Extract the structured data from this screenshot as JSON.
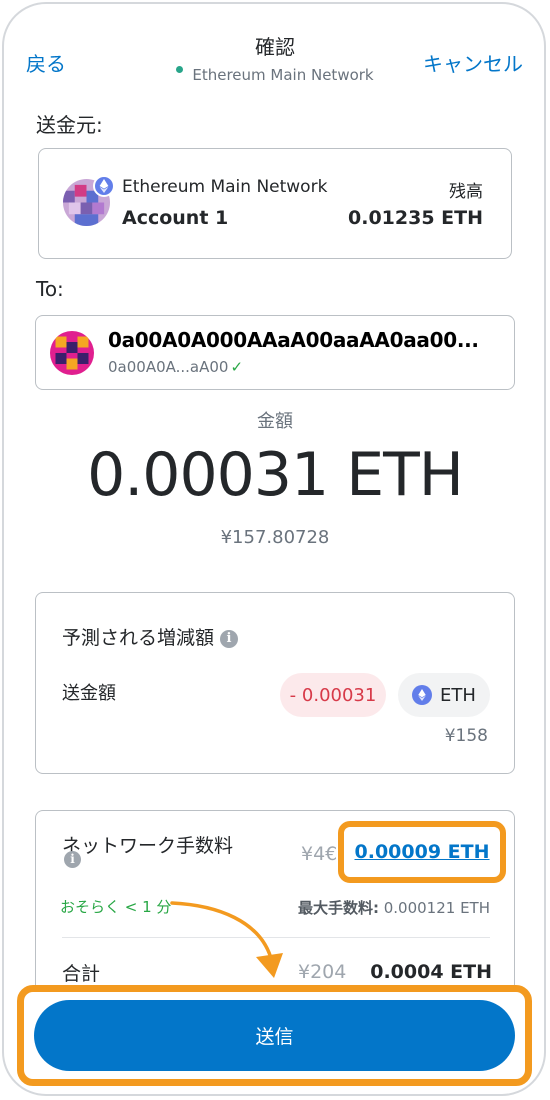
{
  "header": {
    "back_label": "戻る",
    "title": "確認",
    "network": "Ethereum Main Network",
    "cancel_label": "キャンセル"
  },
  "from": {
    "label": "送金元:",
    "network": "Ethereum Main Network",
    "balance_label": "残高",
    "account": "Account 1",
    "balance": "0.01235 ETH",
    "badge_icon": "ethereum-icon"
  },
  "to": {
    "label": "To:",
    "address": "0a00A0A000AAaA00aaAA0aa00...",
    "short_address": "0a00A0A...aA00",
    "verified_icon": "check-icon"
  },
  "amount": {
    "label": "金額",
    "value": "0.00031 ETH",
    "fiat": "¥157.80728"
  },
  "simulation": {
    "title": "予測される増減額",
    "row_label": "送金額",
    "change": "- 0.00031",
    "token": "ETH",
    "fiat": "¥158"
  },
  "fee": {
    "title": "ネットワーク手数料",
    "fiat": "¥4€",
    "eth": "0.00009 ETH",
    "time": "おそらく < 1 分",
    "max_label": "最大手数料:",
    "max_value": "0.000121 ETH"
  },
  "total": {
    "label": "合計",
    "fiat": "¥204",
    "eth": "0.0004 ETH"
  },
  "footer": {
    "send_label": "送信"
  },
  "colors": {
    "accent": "#0376c9",
    "highlight": "#f39a1f",
    "success": "#28a745",
    "danger": "#d73a49"
  }
}
